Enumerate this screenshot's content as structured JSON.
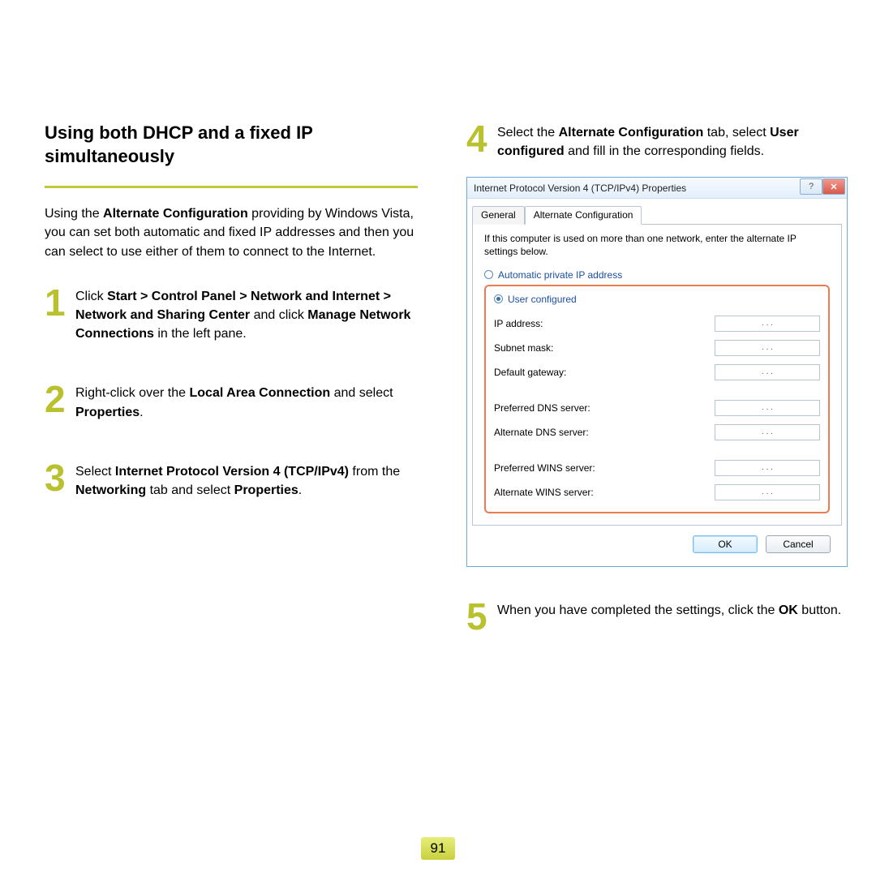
{
  "page_number": "91",
  "section_title": "Using both DHCP and a fixed IP simultaneously",
  "intro_parts": {
    "p1": "Using the ",
    "b1": "Alternate Configuration",
    "p2": " providing by Windows Vista, you can set both automatic and fixed IP addresses and then you can select to use either of them to connect to the Internet."
  },
  "steps": {
    "s1": {
      "num": "1",
      "a": "Click ",
      "b1": "Start > Control Panel > Network and Internet > Network and Sharing Center",
      "c": " and click ",
      "b2": "Manage Network Connections",
      "d": " in the left pane."
    },
    "s2": {
      "num": "2",
      "a": "Right-click over the ",
      "b1": "Local Area Connection",
      "c": " and select ",
      "b2": "Properties",
      "d": "."
    },
    "s3": {
      "num": "3",
      "a": "Select ",
      "b1": "Internet Protocol Version 4 (TCP/IPv4)",
      "c": " from the ",
      "b2": "Networking",
      "d": " tab and select ",
      "b3": "Properties",
      "e": "."
    },
    "s4": {
      "num": "4",
      "a": "Select the ",
      "b1": "Alternate Configuration",
      "c": " tab, select ",
      "b2": "User configured",
      "d": " and fill in the corresponding fields."
    },
    "s5": {
      "num": "5",
      "a": "When you have completed the settings, click the ",
      "b1": "OK",
      "c": " button."
    }
  },
  "dialog": {
    "title": "Internet Protocol Version 4 (TCP/IPv4) Properties",
    "help_glyph": "?",
    "close_glyph": "✕",
    "tabs": {
      "general": "General",
      "alt": "Alternate Configuration"
    },
    "hint": "If this computer is used on more than one network, enter the alternate IP settings below.",
    "radio_auto": "Automatic private IP address",
    "radio_user": "User configured",
    "fields": {
      "ip": "IP address:",
      "subnet": "Subnet mask:",
      "gateway": "Default gateway:",
      "pdns": "Preferred DNS server:",
      "adns": "Alternate DNS server:",
      "pwins": "Preferred WINS server:",
      "awins": "Alternate WINS server:"
    },
    "ip_dots": ".    .    .",
    "ok": "OK",
    "cancel": "Cancel"
  }
}
